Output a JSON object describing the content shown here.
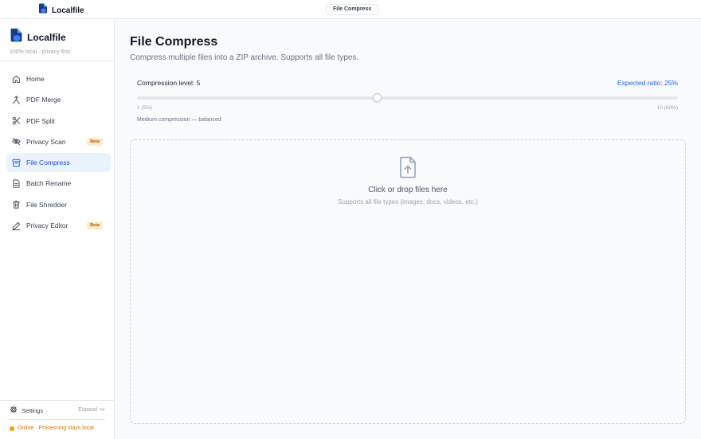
{
  "app": {
    "name": "Localfile",
    "tagline": "100% local · privacy-first"
  },
  "header": {
    "active_tab": "File Compress"
  },
  "sidebar": {
    "items": [
      {
        "label": "Home",
        "icon": "home-icon",
        "active": false,
        "badge": ""
      },
      {
        "label": "PDF Merge",
        "icon": "merge-icon",
        "active": false,
        "badge": ""
      },
      {
        "label": "PDF Split",
        "icon": "scissors-icon",
        "active": false,
        "badge": ""
      },
      {
        "label": "Privacy Scan",
        "icon": "eye-off-icon",
        "active": false,
        "badge": "Beta"
      },
      {
        "label": "File Compress",
        "icon": "archive-icon",
        "active": true,
        "badge": ""
      },
      {
        "label": "Batch Rename",
        "icon": "file-text-icon",
        "active": false,
        "badge": ""
      },
      {
        "label": "File Shredder",
        "icon": "trash-icon",
        "active": false,
        "badge": ""
      },
      {
        "label": "Privacy Editor",
        "icon": "pen-icon",
        "active": false,
        "badge": "Beta"
      }
    ],
    "settings_label": "Settings",
    "expand_label": "Expand",
    "status_text": "Online · Processing stays local"
  },
  "main": {
    "title": "File Compress",
    "subtitle": "Compress multiple files into a ZIP archive. Supports all file types.",
    "compression": {
      "label": "Compression level: 5",
      "level": 5,
      "min": 1,
      "max": 10,
      "ratio_label": "Expected ratio: 25%",
      "min_label": "1 (5%)",
      "max_label": "10 (60%)",
      "description": "Medium compression — balanced"
    },
    "dropzone": {
      "title": "Click or drop files here",
      "subtitle": "Supports all file types (images, docs, videos, etc.)"
    }
  },
  "colors": {
    "accent": "#2563eb",
    "active_bg": "#eaf2fc",
    "beta_bg": "#fdecc8",
    "beta_text": "#b45309",
    "status": "#f59e0b"
  }
}
